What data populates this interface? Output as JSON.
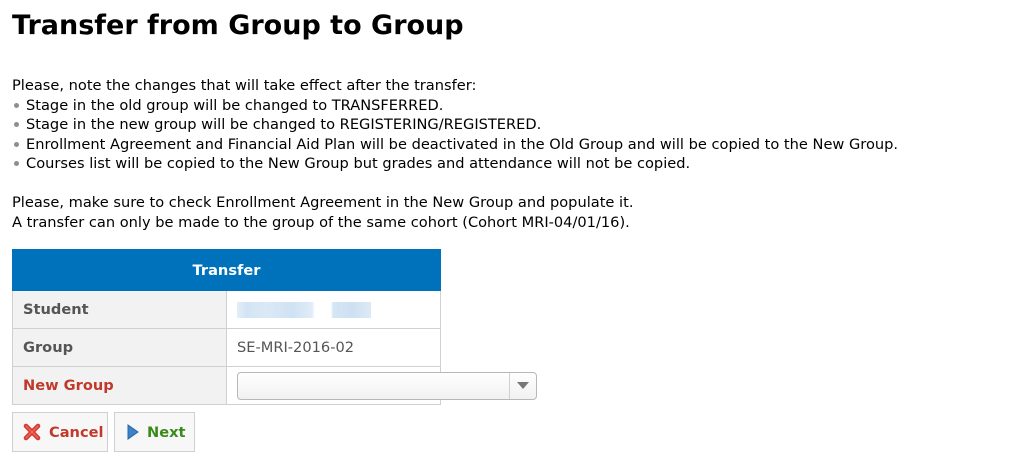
{
  "page": {
    "title": "Transfer from Group to Group"
  },
  "notes": {
    "intro": "Please, note the changes that will take effect after the transfer:",
    "items": [
      "Stage in the old group will be changed to TRANSFERRED.",
      "Stage in the new group will be changed to REGISTERING/REGISTERED.",
      "Enrollment Agreement and Financial Aid Plan will be deactivated in the Old Group and will be copied to the New Group.",
      "Courses list will be copied to the New Group but grades and attendance will not be copied."
    ],
    "check_line": "Please, make sure to check Enrollment Agreement in the New Group and populate it.",
    "cohort_line": "A transfer can only be made to the group of the same cohort (Cohort MRI-04/01/16)."
  },
  "transfer": {
    "header": "Transfer",
    "student_label": "Student",
    "group_label": "Group",
    "group_value": "SE-MRI-2016-02",
    "new_group_label": "New Group",
    "new_group_value": ""
  },
  "buttons": {
    "cancel": "Cancel",
    "next": "Next"
  },
  "colors": {
    "header_bg": "#0072bc",
    "required_label": "#c0392b",
    "next_text": "#3a8a1a"
  },
  "icons": {
    "cancel": "red-x-icon",
    "next": "blue-play-arrow-icon",
    "select": "chevron-down-icon"
  }
}
